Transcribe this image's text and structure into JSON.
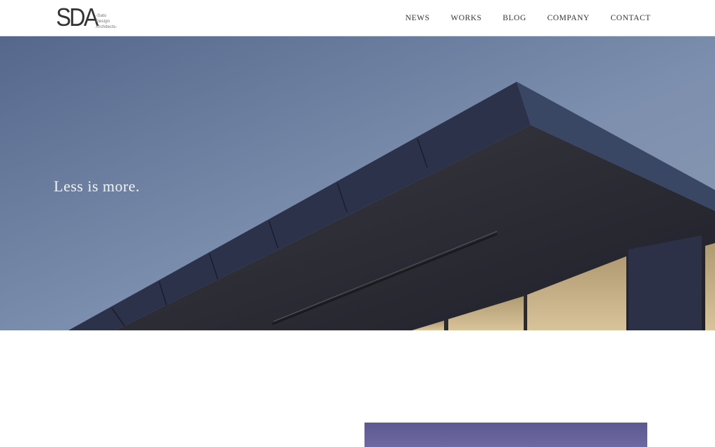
{
  "brand": {
    "mark": "SDA",
    "sub_lines": [
      "-Sato",
      "Design",
      "Architects-"
    ]
  },
  "nav": {
    "items": [
      "NEWS",
      "WORKS",
      "BLOG",
      "COMPANY",
      "CONTACT"
    ]
  },
  "hero": {
    "tagline": "Less is more.",
    "sky_color": "#6f84a6",
    "roof_color": "#2f3347"
  }
}
